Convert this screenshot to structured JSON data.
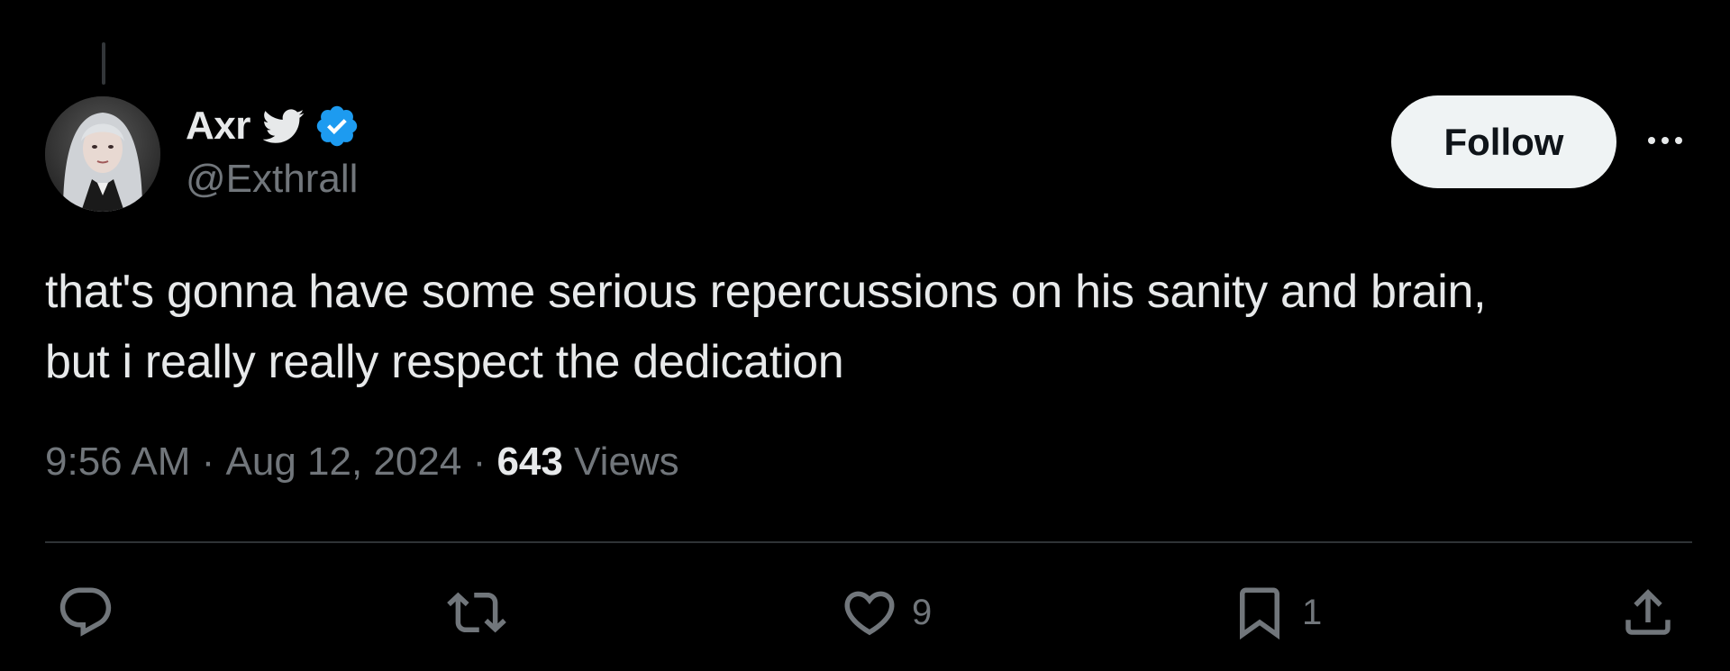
{
  "tweet": {
    "author": {
      "display_name": "Axr",
      "handle": "@Exthrall"
    },
    "text_line1": "that's gonna have some serious repercussions on his sanity and brain,",
    "text_line2": "but i really really respect the dedication",
    "time": "9:56 AM",
    "separator": " · ",
    "date": "Aug 12, 2024",
    "views_count": "643",
    "views_label": "Views",
    "follow_label": "Follow",
    "likes_count": "9",
    "bookmarks_count": "1"
  },
  "icons": {
    "bird": "bird-icon",
    "verified": "verified-badge-icon",
    "more": "more-dots-icon",
    "reply": "reply-icon",
    "retweet": "retweet-icon",
    "like": "heart-icon",
    "bookmark": "bookmark-icon",
    "share": "share-icon"
  },
  "colors": {
    "background": "#000000",
    "text_primary": "#e7e9ea",
    "text_secondary": "#71767b",
    "verified_blue": "#1d9bf0",
    "follow_bg": "#eff3f4",
    "divider": "#2f3336"
  }
}
